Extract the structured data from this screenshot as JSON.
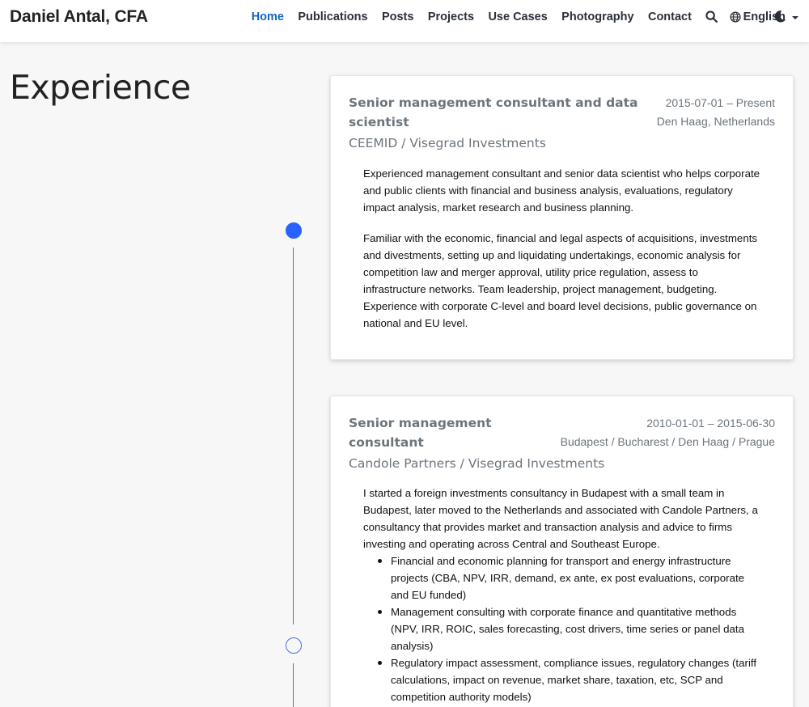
{
  "site": {
    "brand": "Daniel Antal, CFA"
  },
  "nav": {
    "items": [
      {
        "label": "Home",
        "active": true
      },
      {
        "label": "Publications",
        "active": false
      },
      {
        "label": "Posts",
        "active": false
      },
      {
        "label": "Projects",
        "active": false
      },
      {
        "label": "Use Cases",
        "active": false
      },
      {
        "label": "Photography",
        "active": false
      },
      {
        "label": "Contact",
        "active": false
      }
    ],
    "search_icon": "search-icon",
    "language": "English",
    "language_icon": "globe-icon",
    "theme_icon": "moon-icon"
  },
  "page": {
    "title": "Experience"
  },
  "experience": [
    {
      "role": "Senior management consultant and data scientist",
      "organization": "CEEMID / Visegrad Investments",
      "dates": "2015-07-01 – Present",
      "location": "Den Haag, Netherlands",
      "paragraphs": [
        "Experienced management consultant and senior data scientist who helps corporate and public clients with financial and business analysis, evaluations, regulatory impact analysis, market research and business planning.",
        "Familiar with the economic, financial and legal aspects of acquisitions, investments and divestments, setting up and liquidating undertakings, economic analysis for competition law and merger approval, utility price regulation, assess to infrastructure networks. Team leadership, project management, budgeting. Experience with corporate C-level and board level decisions, public governance on national and EU level."
      ]
    },
    {
      "role": "Senior management consultant",
      "organization": "Candole Partners / Visegrad Investments",
      "dates": "2010-01-01 – 2015-06-30",
      "location": "Budapest / Bucharest / Den Haag / Prague",
      "paragraphs": [
        "I started a foreign investments consultancy in Budapest with a small team in Budapest, later moved to the Netherlands and associated with Candole Partners, a consultancy that provides market and transaction analysis and advice to firms investing and operating across Central and Southeast Europe."
      ],
      "bullets": [
        "Financial and economic planning for transport and energy infrastructure projects (CBA, NPV, IRR, demand, ex ante, ex post evaluations, corporate and EU funded)",
        "Management consulting with corporate finance and quantitative methods (NPV, IRR, ROIC, sales forecasting, cost drivers, time series or panel data analysis)",
        "Regulatory impact assessment, compliance issues, regulatory changes (tariff calculations, impact on revenue, market share, taxation, etc, SCP and competition authority models)"
      ]
    }
  ],
  "colors": {
    "accent": "#1565c0",
    "timeline": "#2962ff",
    "muted": "#6c757d"
  }
}
